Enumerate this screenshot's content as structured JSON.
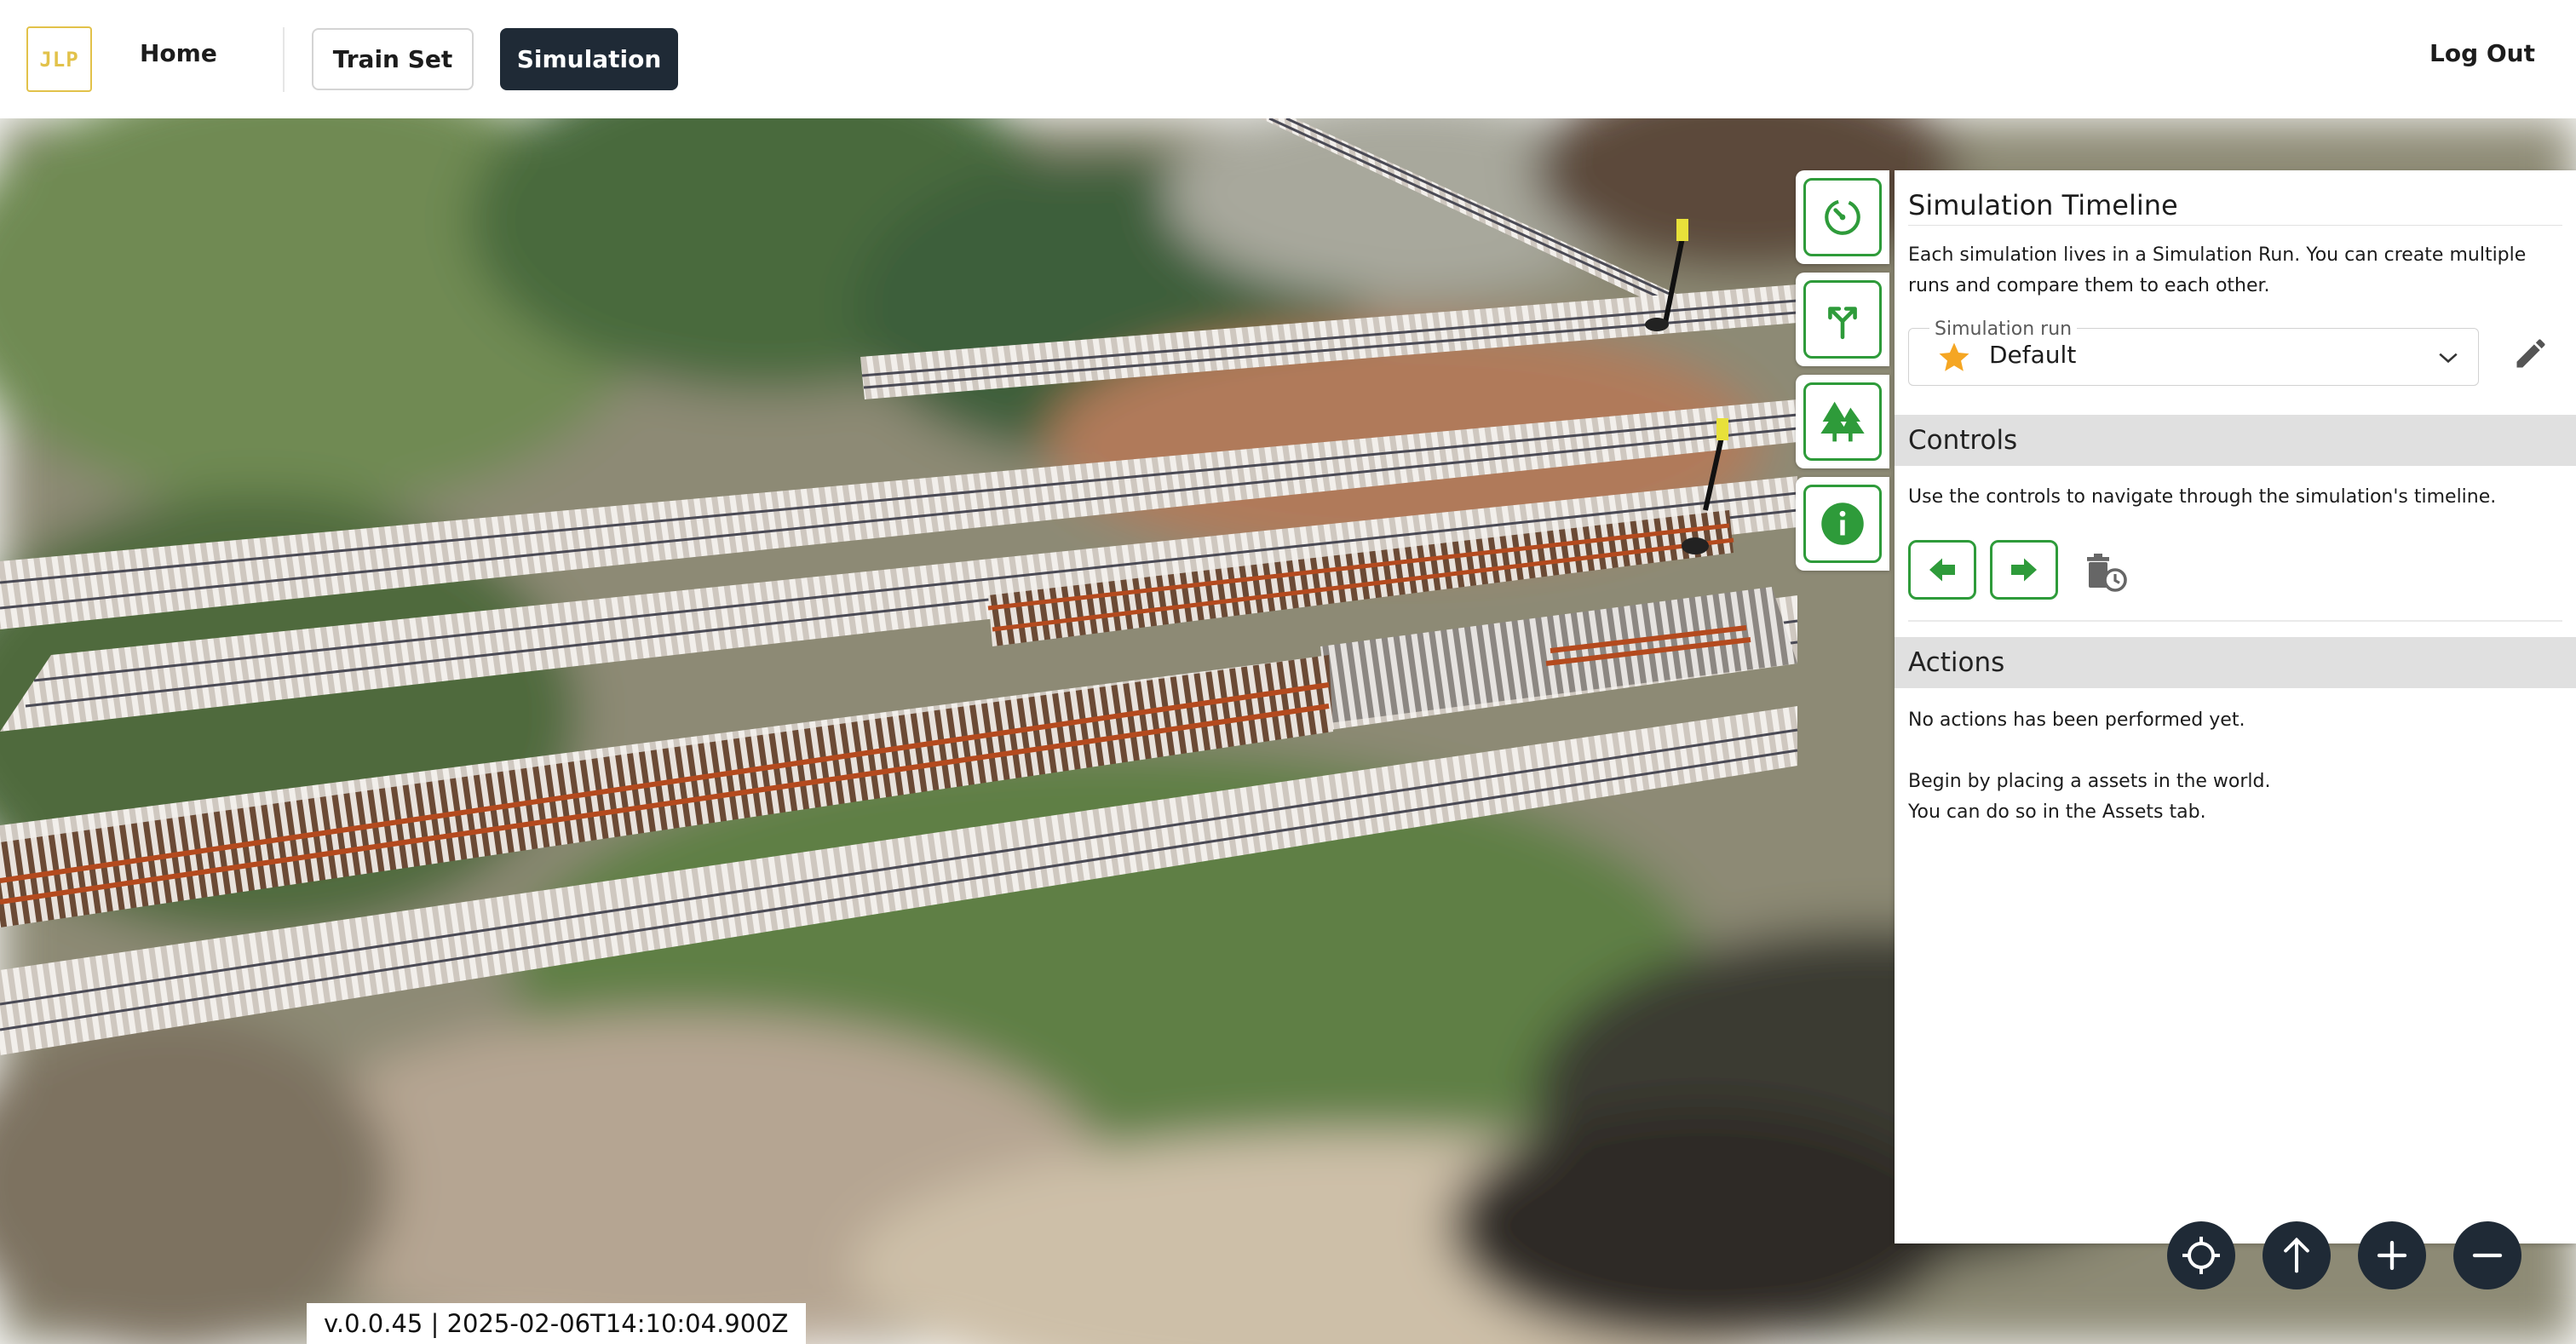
{
  "header": {
    "logo_text": "JLP",
    "home_label": "Home",
    "trainset_label": "Train Set",
    "simulation_label": "Simulation",
    "logout_label": "Log Out"
  },
  "panel": {
    "title": "Simulation Timeline",
    "description": "Each simulation lives in a Simulation Run. You can create multiple runs and compare them to each other.",
    "run_select": {
      "label": "Simulation run",
      "value": "Default"
    },
    "controls": {
      "header": "Controls",
      "description": "Use the controls to navigate through the simulation's timeline."
    },
    "actions": {
      "header": "Actions",
      "empty_text": "No actions has been performed yet.",
      "hint_line1": "Begin by placing a assets in the world.",
      "hint_line2": "You can do so in the Assets tab."
    }
  },
  "side_tabs": [
    "timeline-icon",
    "switch-icon",
    "trees-icon",
    "info-icon"
  ],
  "map_controls": [
    "locate-icon",
    "north-arrow-icon",
    "zoom-in-icon",
    "zoom-out-icon"
  ],
  "version": "v.0.0.45 | 2025-02-06T14:10:04.900Z",
  "colors": {
    "accent_green": "#2e9b3a",
    "dark": "#1f2a36",
    "logo_yellow": "#e2c24a"
  }
}
